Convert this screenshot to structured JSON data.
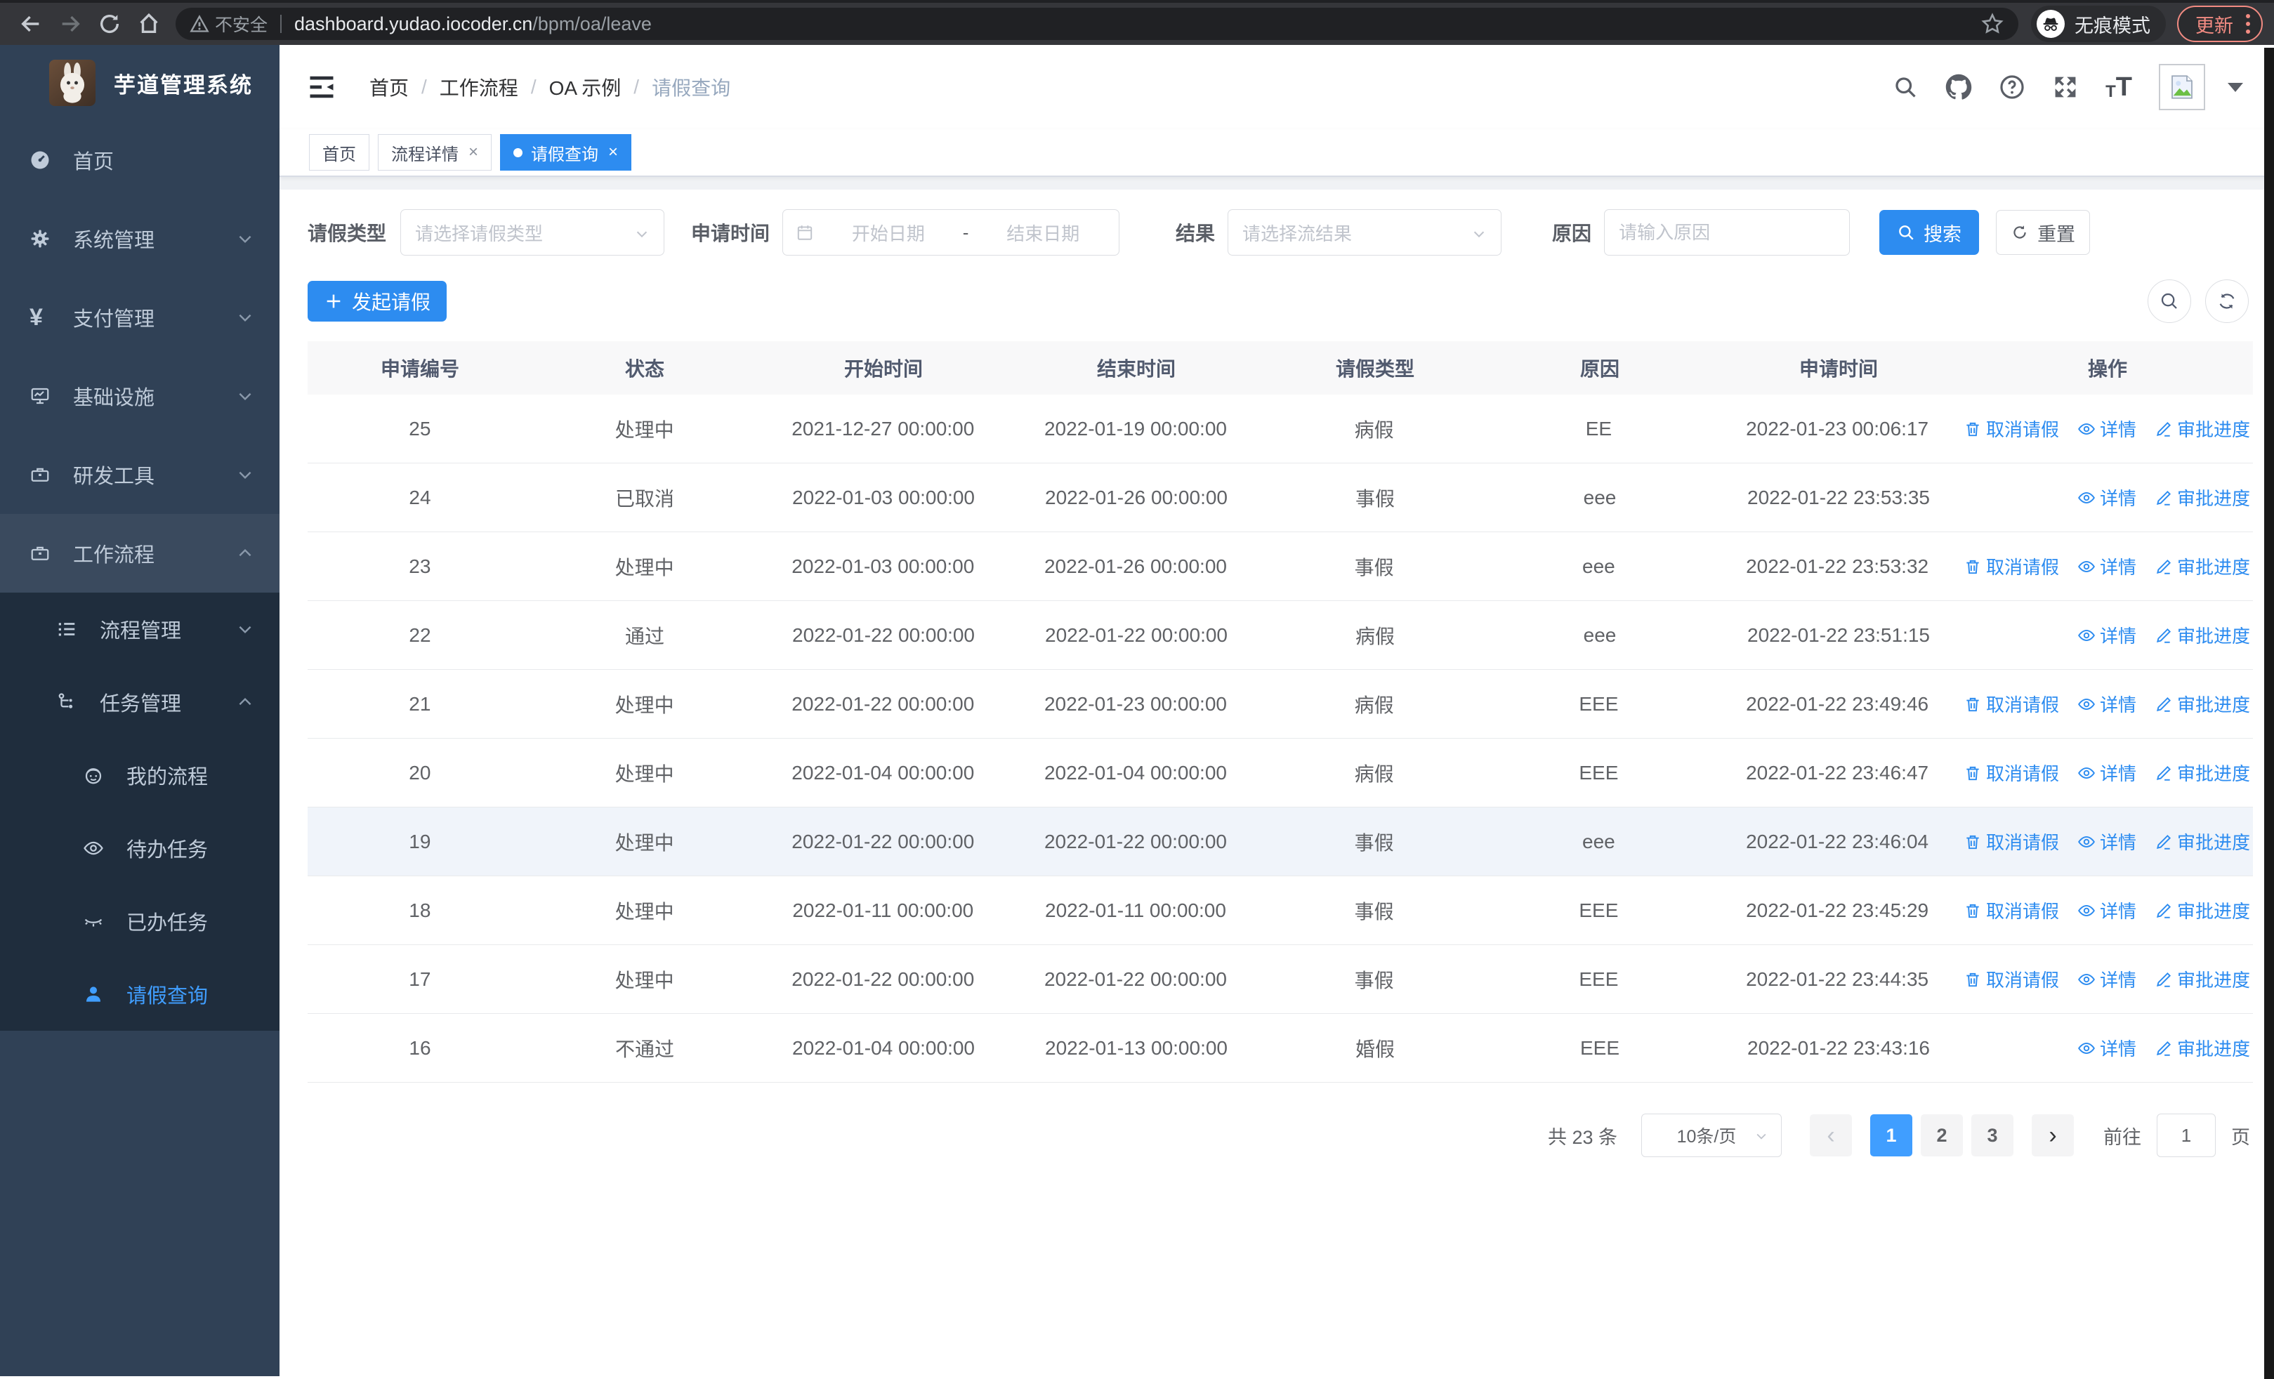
{
  "browser": {
    "security_label": "不安全",
    "url_host": "dashboard.yudao.iocoder.cn",
    "url_path": "/bpm/oa/leave",
    "incognito_label": "无痕模式",
    "update_label": "更新"
  },
  "sidebar": {
    "logo_title": "芋道管理系统",
    "items": [
      {
        "label": "首页"
      },
      {
        "label": "系统管理"
      },
      {
        "label": "支付管理"
      },
      {
        "label": "基础设施"
      },
      {
        "label": "研发工具"
      },
      {
        "label": "工作流程"
      },
      {
        "label": "流程管理"
      },
      {
        "label": "任务管理"
      },
      {
        "label": "我的流程"
      },
      {
        "label": "待办任务"
      },
      {
        "label": "已办任务"
      },
      {
        "label": "请假查询"
      }
    ]
  },
  "breadcrumb": {
    "separator": "/",
    "items": [
      "首页",
      "工作流程",
      "OA 示例",
      "请假查询"
    ]
  },
  "tabs": [
    {
      "label": "首页"
    },
    {
      "label": "流程详情"
    },
    {
      "label": "请假查询"
    }
  ],
  "filters": {
    "leave_type_label": "请假类型",
    "leave_type_placeholder": "请选择请假类型",
    "apply_time_label": "申请时间",
    "date_start_placeholder": "开始日期",
    "date_separator": "-",
    "date_end_placeholder": "结束日期",
    "result_label": "结果",
    "result_placeholder": "请选择流结果",
    "reason_label": "原因",
    "reason_placeholder": "请输入原因",
    "search_button": "搜索",
    "reset_button": "重置"
  },
  "toolbar": {
    "create_button": "发起请假"
  },
  "table": {
    "columns": [
      "申请编号",
      "状态",
      "开始时间",
      "结束时间",
      "请假类型",
      "原因",
      "申请时间",
      "操作"
    ],
    "action_labels": {
      "cancel": "取消请假",
      "detail": "详情",
      "progress": "审批进度"
    },
    "rows": [
      {
        "id": "25",
        "status": "处理中",
        "start": "2021-12-27 00:00:00",
        "end": "2022-01-19 00:00:00",
        "type": "病假",
        "reason": "EE",
        "applied": "2022-01-23 00:06:17",
        "actions": [
          "cancel",
          "detail",
          "progress"
        ],
        "hover": false
      },
      {
        "id": "24",
        "status": "已取消",
        "start": "2022-01-03 00:00:00",
        "end": "2022-01-26 00:00:00",
        "type": "事假",
        "reason": "eee",
        "applied": "2022-01-22 23:53:35",
        "actions": [
          "detail",
          "progress"
        ],
        "hover": false
      },
      {
        "id": "23",
        "status": "处理中",
        "start": "2022-01-03 00:00:00",
        "end": "2022-01-26 00:00:00",
        "type": "事假",
        "reason": "eee",
        "applied": "2022-01-22 23:53:32",
        "actions": [
          "cancel",
          "detail",
          "progress"
        ],
        "hover": false
      },
      {
        "id": "22",
        "status": "通过",
        "start": "2022-01-22 00:00:00",
        "end": "2022-01-22 00:00:00",
        "type": "病假",
        "reason": "eee",
        "applied": "2022-01-22 23:51:15",
        "actions": [
          "detail",
          "progress"
        ],
        "hover": false
      },
      {
        "id": "21",
        "status": "处理中",
        "start": "2022-01-22 00:00:00",
        "end": "2022-01-23 00:00:00",
        "type": "病假",
        "reason": "EEE",
        "applied": "2022-01-22 23:49:46",
        "actions": [
          "cancel",
          "detail",
          "progress"
        ],
        "hover": false
      },
      {
        "id": "20",
        "status": "处理中",
        "start": "2022-01-04 00:00:00",
        "end": "2022-01-04 00:00:00",
        "type": "病假",
        "reason": "EEE",
        "applied": "2022-01-22 23:46:47",
        "actions": [
          "cancel",
          "detail",
          "progress"
        ],
        "hover": false
      },
      {
        "id": "19",
        "status": "处理中",
        "start": "2022-01-22 00:00:00",
        "end": "2022-01-22 00:00:00",
        "type": "事假",
        "reason": "eee",
        "applied": "2022-01-22 23:46:04",
        "actions": [
          "cancel",
          "detail",
          "progress"
        ],
        "hover": true
      },
      {
        "id": "18",
        "status": "处理中",
        "start": "2022-01-11 00:00:00",
        "end": "2022-01-11 00:00:00",
        "type": "事假",
        "reason": "EEE",
        "applied": "2022-01-22 23:45:29",
        "actions": [
          "cancel",
          "detail",
          "progress"
        ],
        "hover": false
      },
      {
        "id": "17",
        "status": "处理中",
        "start": "2022-01-22 00:00:00",
        "end": "2022-01-22 00:00:00",
        "type": "事假",
        "reason": "EEE",
        "applied": "2022-01-22 23:44:35",
        "actions": [
          "cancel",
          "detail",
          "progress"
        ],
        "hover": false
      },
      {
        "id": "16",
        "status": "不通过",
        "start": "2022-01-04 00:00:00",
        "end": "2022-01-13 00:00:00",
        "type": "婚假",
        "reason": "EEE",
        "applied": "2022-01-22 23:43:16",
        "actions": [
          "detail",
          "progress"
        ],
        "hover": false
      }
    ]
  },
  "pagination": {
    "total_label": "共 23 条",
    "page_size": "10条/页",
    "pages": [
      "1",
      "2",
      "3"
    ],
    "active_page": "1",
    "goto_label": "前往",
    "goto_value": "1",
    "goto_suffix": "页"
  },
  "colors": {
    "primary": "#2d8cf0",
    "pagination_active": "#409eff",
    "sidebar_bg": "#304156",
    "submenu_bg": "#1f2d3d",
    "update_accent": "#f28b82"
  }
}
